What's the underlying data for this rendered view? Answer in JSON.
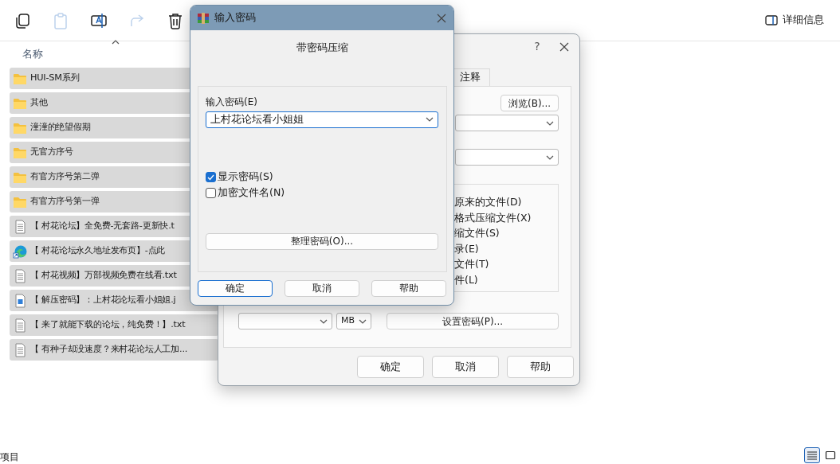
{
  "explorer": {
    "toolbar": [
      {
        "kind": "copy",
        "disabled": false
      },
      {
        "kind": "paste",
        "disabled": true
      },
      {
        "kind": "rename",
        "disabled": false
      },
      {
        "kind": "share",
        "disabled": true
      },
      {
        "kind": "delete",
        "disabled": false
      }
    ],
    "details_button": "详细信息",
    "column_header": "名称",
    "files": [
      {
        "name": "HUI-SM系列",
        "kind": "folder",
        "selected": true
      },
      {
        "name": "其他",
        "kind": "folder",
        "selected": true
      },
      {
        "name": "潼潼的绝望假期",
        "kind": "folder",
        "selected": true
      },
      {
        "name": "无官方序号",
        "kind": "folder",
        "selected": true
      },
      {
        "name": "有官方序号第二弹",
        "kind": "folder",
        "selected": true
      },
      {
        "name": "有官方序号第一弹",
        "kind": "folder",
        "selected": true
      },
      {
        "name": "【 村花论坛】全免费-无套路-更新快.t",
        "kind": "text",
        "selected": true
      },
      {
        "name": "【 村花论坛永久地址发布页】-点此",
        "kind": "shortcut",
        "selected": true
      },
      {
        "name": "【 村花视频】万部视频免费在线看.txt",
        "kind": "text",
        "selected": true
      },
      {
        "name": "【 解压密码】：上村花论坛看小姐姐.j",
        "kind": "image",
        "selected": true
      },
      {
        "name": "【 来了就能下载的论坛，纯免费！】.txt",
        "kind": "text",
        "selected": true
      },
      {
        "name": "【 有种子却没速度？来村花论坛人工加...",
        "kind": "text",
        "selected": true
      }
    ],
    "status_bar": "项目",
    "view_buttons": [
      {
        "kind": "details",
        "selected": true
      },
      {
        "kind": "tiles",
        "selected": false
      }
    ]
  },
  "archive_dialog": {
    "help_glyph": "?",
    "tabs": [
      {
        "label": "注释",
        "selected": false
      }
    ],
    "browse_button": "浏览(B)...",
    "options": [
      "原来的文件(D)",
      "格式压缩文件(X)",
      "缩文件(S)",
      "录(E)",
      "文件(T)",
      "件(L)"
    ],
    "split_unit": "MB",
    "set_password_button": "设置密码(P)...",
    "buttons": [
      "确定",
      "取消",
      "帮助"
    ]
  },
  "password_dialog": {
    "title": "输入密码",
    "heading": "带密码压缩",
    "password_label": "输入密码(E)",
    "password_value": "上村花论坛看小姐姐",
    "checkboxes": [
      {
        "label": "显示密码(S)",
        "checked": true
      },
      {
        "label": "加密文件名(N)",
        "checked": false
      }
    ],
    "organize_button": "整理密码(O)...",
    "buttons": [
      {
        "label": "确定",
        "default": true
      },
      {
        "label": "取消",
        "default": false
      },
      {
        "label": "帮助",
        "default": false
      }
    ]
  }
}
